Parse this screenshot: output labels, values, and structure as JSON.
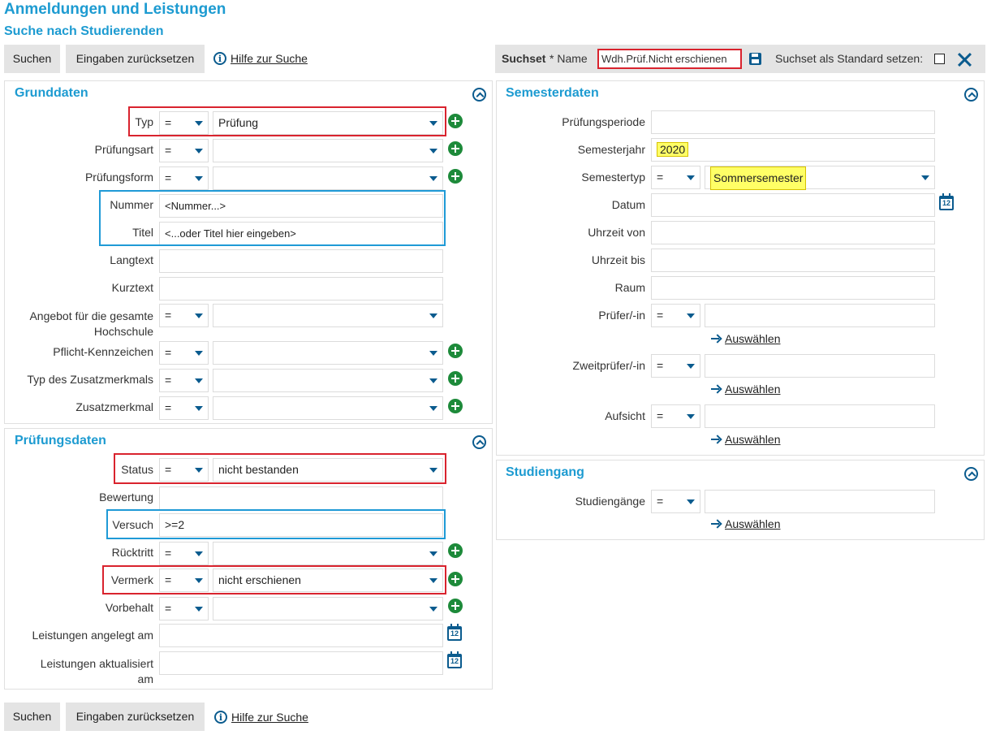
{
  "page": {
    "title": "Anmeldungen und Leistungen",
    "subtitle": "Suche nach Studierenden"
  },
  "actions": {
    "search": "Suchen",
    "reset": "Eingaben zurücksetzen",
    "help": "Hilfe zur Suche"
  },
  "suchset": {
    "label": "Suchset",
    "name_label": "* Name",
    "name_value": "Wdh.Prüf.Nicht erschienen",
    "default_label": "Suchset als Standard setzen:"
  },
  "grunddaten": {
    "title": "Grunddaten",
    "typ": {
      "label": "Typ",
      "op": "=",
      "value": "Prüfung"
    },
    "pruefungsart": {
      "label": "Prüfungsart",
      "op": "=",
      "value": ""
    },
    "pruefungsform": {
      "label": "Prüfungsform",
      "op": "=",
      "value": ""
    },
    "nummer": {
      "label": "Nummer",
      "placeholder": "<Nummer...>"
    },
    "titel": {
      "label": "Titel",
      "placeholder": "<...oder Titel hier eingeben>"
    },
    "langtext": {
      "label": "Langtext"
    },
    "kurztext": {
      "label": "Kurztext"
    },
    "angebot": {
      "label_1": "Angebot für die gesamte",
      "label_2": "Hochschule",
      "op": "=",
      "value": ""
    },
    "pflicht": {
      "label": "Pflicht-Kennzeichen",
      "op": "=",
      "value": ""
    },
    "typ_zusatz": {
      "label": "Typ des Zusatzmerkmals",
      "op": "=",
      "value": ""
    },
    "zusatzmerkmal": {
      "label": "Zusatzmerkmal",
      "op": "=",
      "value": ""
    }
  },
  "pruefungsdaten": {
    "title": "Prüfungsdaten",
    "status": {
      "label": "Status",
      "op": "=",
      "value": "nicht bestanden"
    },
    "bewertung": {
      "label": "Bewertung"
    },
    "versuch": {
      "label": "Versuch",
      "value": ">=2"
    },
    "ruecktritt": {
      "label": "Rücktritt",
      "op": "=",
      "value": ""
    },
    "vermerk": {
      "label": "Vermerk",
      "op": "=",
      "value": "nicht erschienen"
    },
    "vorbehalt": {
      "label": "Vorbehalt",
      "op": "=",
      "value": ""
    },
    "angelegt": {
      "label": "Leistungen angelegt am"
    },
    "aktualisiert": {
      "label_1": "Leistungen aktualisiert",
      "label_2": "am"
    }
  },
  "semesterdaten": {
    "title": "Semesterdaten",
    "periode": {
      "label": "Prüfungsperiode"
    },
    "jahr": {
      "label": "Semesterjahr",
      "value": "2020"
    },
    "typ": {
      "label": "Semestertyp",
      "op": "=",
      "value": "Sommersemester"
    },
    "datum": {
      "label": "Datum"
    },
    "von": {
      "label": "Uhrzeit von"
    },
    "bis": {
      "label": "Uhrzeit bis"
    },
    "raum": {
      "label": "Raum"
    },
    "pruefer": {
      "label": "Prüfer/-in",
      "op": "="
    },
    "zweitpruefer": {
      "label": "Zweitprüfer/-in",
      "op": "="
    },
    "aufsicht": {
      "label": "Aufsicht",
      "op": "="
    },
    "select_link": "Auswählen"
  },
  "studiengang": {
    "title": "Studiengang",
    "studiengaenge": {
      "label": "Studiengänge",
      "op": "="
    },
    "select_link": "Auswählen"
  },
  "icons": {
    "calendar_day": "12",
    "info": "i"
  }
}
